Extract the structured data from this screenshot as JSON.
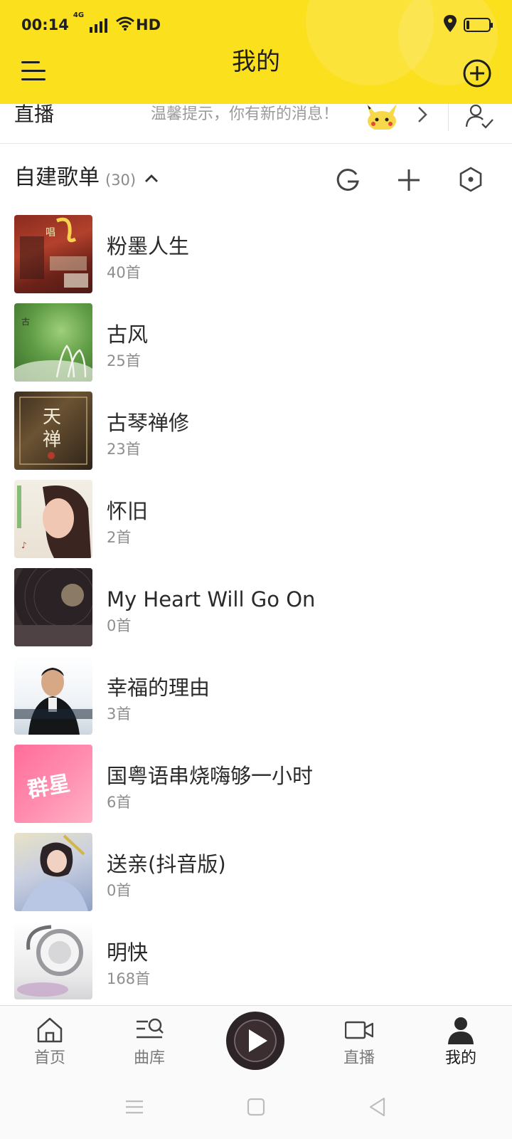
{
  "status_bar": {
    "time": "00:14",
    "network": "4G",
    "wifi_label": "HD"
  },
  "header": {
    "title": "我的",
    "background_color": "#fbe01e"
  },
  "live": {
    "label": "直播",
    "tip": "温馨提示，你有新的消息！"
  },
  "section": {
    "title": "自建歌单",
    "count": "(30)"
  },
  "playlists": [
    {
      "name": "粉墨人生",
      "count": "40首"
    },
    {
      "name": "古风",
      "count": "25首"
    },
    {
      "name": "古琴禅修",
      "count": "23首"
    },
    {
      "name": "怀旧",
      "count": "2首"
    },
    {
      "name": "My Heart Will Go On",
      "count": "0首"
    },
    {
      "name": "幸福的理由",
      "count": "3首"
    },
    {
      "name": "国粤语串烧嗨够一小时",
      "count": "6首"
    },
    {
      "name": "送亲(抖音版)",
      "count": "0首"
    },
    {
      "name": "明快",
      "count": "168首"
    }
  ],
  "covers": {
    "cover_1_text": "唱",
    "cover_3_text": "天禅",
    "cover_7_text": "群星"
  },
  "bottom_nav": [
    {
      "label": "首页"
    },
    {
      "label": "曲库"
    },
    {
      "label": "直播"
    },
    {
      "label": "我的"
    }
  ]
}
